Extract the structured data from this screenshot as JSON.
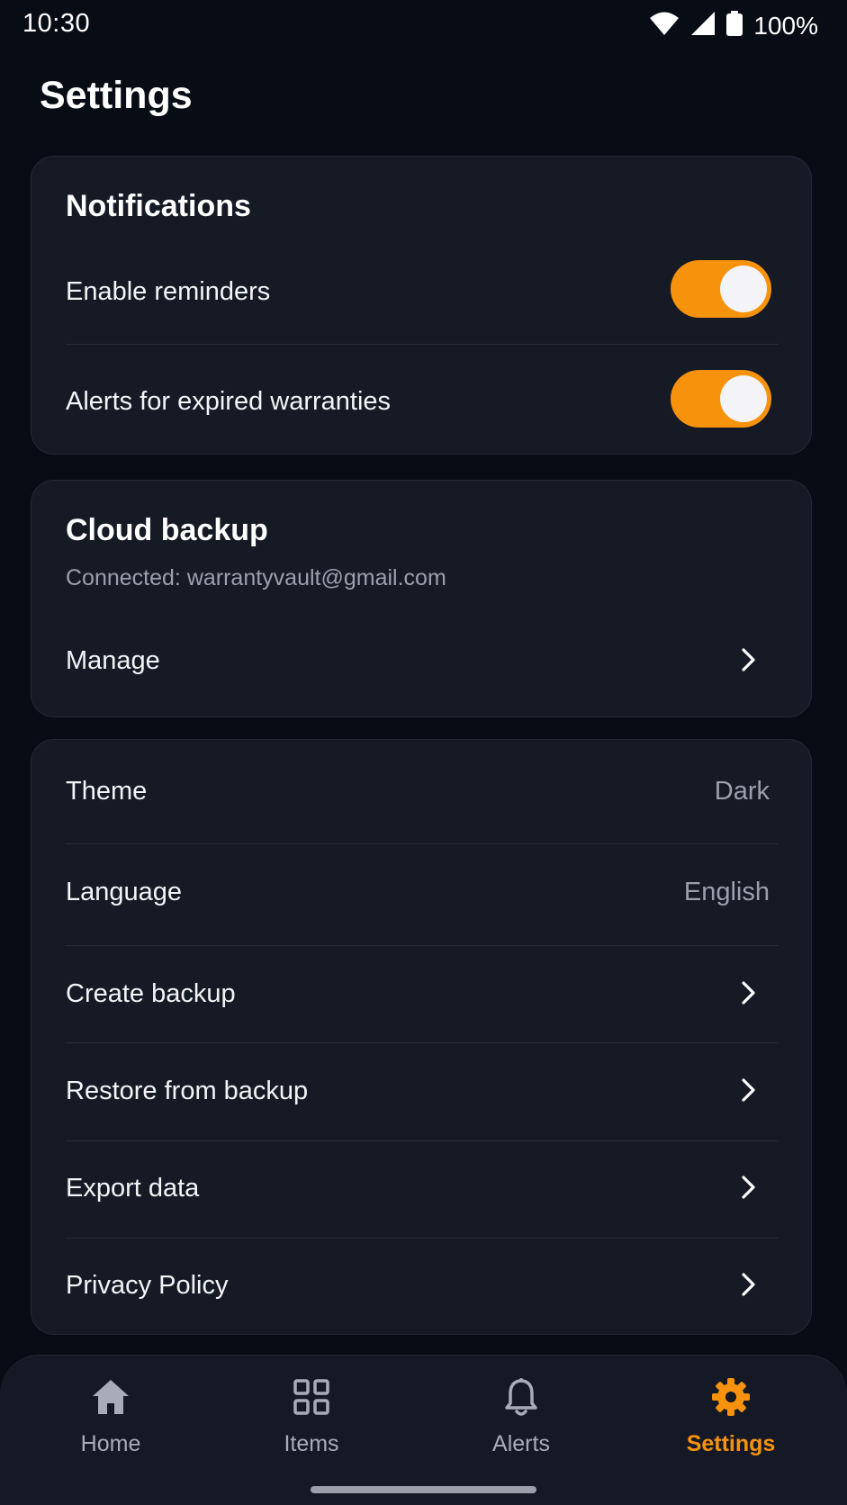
{
  "status_bar": {
    "time": "10:30",
    "battery": "100%"
  },
  "page": {
    "title": "Settings"
  },
  "notifications": {
    "title": "Notifications",
    "rows": [
      {
        "label": "Enable reminders",
        "enabled": true
      },
      {
        "label": "Alerts for expired warranties",
        "enabled": true
      }
    ]
  },
  "cloud_backup": {
    "title": "Cloud backup",
    "subtitle": "Connected: warrantyvault@gmail.com",
    "manage_label": "Manage"
  },
  "general": {
    "theme_label": "Theme",
    "theme_value": "Dark",
    "language_label": "Language",
    "language_value": "English",
    "create_backup_label": "Create backup",
    "restore_label": "Restore from backup",
    "export_label": "Export data",
    "privacy_label": "Privacy Policy"
  },
  "bottom_nav": {
    "items": [
      {
        "label": "Home",
        "icon": "home-icon",
        "active": false
      },
      {
        "label": "Items",
        "icon": "grid-icon",
        "active": false
      },
      {
        "label": "Alerts",
        "icon": "bell-icon",
        "active": false
      },
      {
        "label": "Settings",
        "icon": "gear-icon",
        "active": true
      }
    ]
  },
  "colors": {
    "accent": "#f7920d",
    "background": "#080c14",
    "card": "#151a25",
    "muted_text": "#9aa1ad"
  }
}
